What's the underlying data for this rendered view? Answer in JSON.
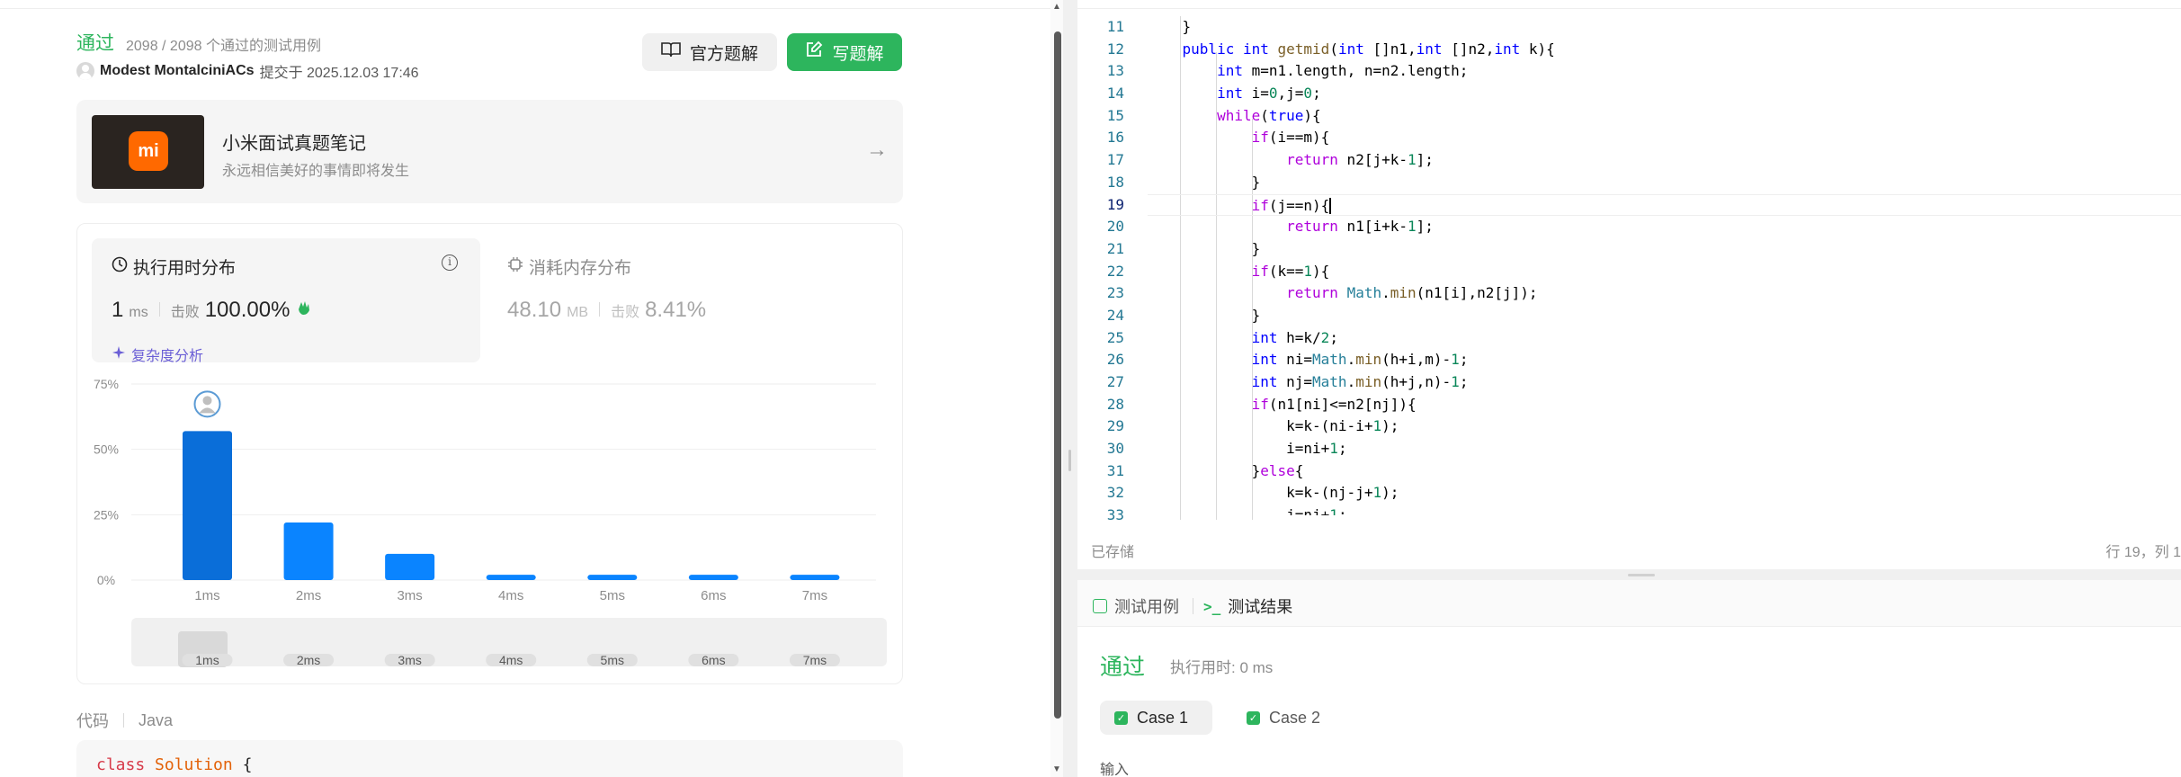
{
  "submission": {
    "status": "通过",
    "tests_passed": "2098 / 2098 个通过的测试用例",
    "author": "Modest MontalciniACs",
    "submitted_at": "提交于 2025.12.03 17:46",
    "official_solution_label": "官方题解",
    "write_solution_label": "写题解"
  },
  "promo": {
    "logo_text": "mi",
    "title": "小米面试真题笔记",
    "subtitle": "永远相信美好的事情即将发生"
  },
  "runtime": {
    "title": "执行用时分布",
    "value": "1",
    "unit": "ms",
    "beats_label": "击败",
    "beats_value": "100.00%",
    "complexity_label": "复杂度分析"
  },
  "memory": {
    "title": "消耗内存分布",
    "value": "48.10",
    "unit": "MB",
    "beats_label": "击败",
    "beats_value": "8.41%"
  },
  "chart_data": {
    "type": "bar",
    "categories": [
      "1ms",
      "2ms",
      "3ms",
      "4ms",
      "5ms",
      "6ms",
      "7ms"
    ],
    "values": [
      57,
      22,
      10,
      2,
      2,
      2,
      2
    ],
    "y_ticks": [
      "75%",
      "50%",
      "25%",
      "0%"
    ],
    "ylim": [
      0,
      75
    ],
    "highlight_index": 0,
    "bar_color": "#0a84ff",
    "highlight_color": "#0a6ed9",
    "brush_labels": [
      "1ms",
      "2ms",
      "3ms",
      "4ms",
      "5ms",
      "6ms",
      "7ms"
    ],
    "grid": true
  },
  "code_section": {
    "label": "代码",
    "language": "Java",
    "first_line_kw": "class",
    "first_line_name": "Solution",
    "first_line_rest": " {"
  },
  "editor": {
    "line_numbers": [
      "11",
      "12",
      "13",
      "14",
      "15",
      "16",
      "17",
      "18",
      "19",
      "20",
      "21",
      "22",
      "23",
      "24",
      "25",
      "26",
      "27",
      "28",
      "29",
      "30",
      "31",
      "32",
      "33"
    ],
    "active_line": "19",
    "saved_label": "已存储",
    "cursor_label": "行 19，列 1"
  },
  "tests": {
    "tab_cases": "测试用例",
    "tab_results": "测试结果",
    "result_status": "通过",
    "result_time": "执行用时: 0 ms",
    "case1": "Case 1",
    "case2": "Case 2",
    "input_label": "输入"
  }
}
